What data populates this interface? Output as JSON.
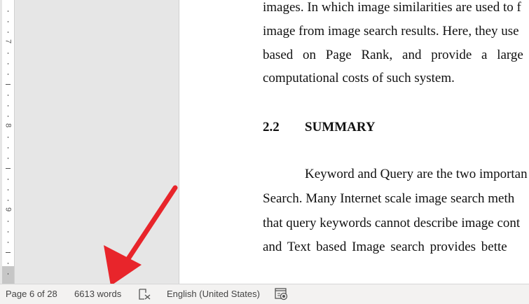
{
  "ruler": {
    "numbers": [
      "7",
      "8",
      "9"
    ]
  },
  "document": {
    "lines": [
      "images. In which image similarities are used to f",
      "image from image search results. Here, they use",
      "based on Page Rank, and provide a large",
      "computational costs of such system."
    ],
    "heading_num": "2.2",
    "heading": "SUMMARY",
    "para": [
      "Keyword and Query are the two importan",
      "Search. Many Internet scale image search meth",
      "that query keywords cannot describe image cont",
      "and Text based Image search provides bette"
    ]
  },
  "status": {
    "page": "Page 6 of 28",
    "words": "6613 words",
    "proofing_icon": "proofing-error-icon",
    "language": "English (United States)",
    "focus_icon": "focus-mode-icon"
  },
  "annotation": {
    "arrow_color": "#e8252b"
  }
}
